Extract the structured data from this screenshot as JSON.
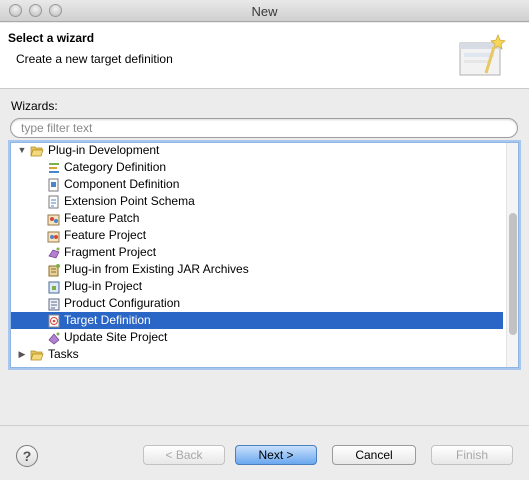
{
  "window": {
    "title": "New"
  },
  "header": {
    "title": "Select a wizard",
    "description": "Create a new target definition",
    "icon": "wizard-banner-icon"
  },
  "wizards_label": "Wizards:",
  "filter": {
    "placeholder": "type filter text",
    "value": ""
  },
  "tree": {
    "root": {
      "label": "Plug-in Development",
      "expanded": true
    },
    "children": [
      {
        "label": "Category Definition",
        "icon": "category-icon"
      },
      {
        "label": "Component Definition",
        "icon": "component-icon"
      },
      {
        "label": "Extension Point Schema",
        "icon": "schema-icon"
      },
      {
        "label": "Feature Patch",
        "icon": "feature-patch-icon"
      },
      {
        "label": "Feature Project",
        "icon": "feature-project-icon"
      },
      {
        "label": "Fragment Project",
        "icon": "fragment-icon"
      },
      {
        "label": "Plug-in from Existing JAR Archives",
        "icon": "jar-plugin-icon"
      },
      {
        "label": "Plug-in Project",
        "icon": "plugin-project-icon"
      },
      {
        "label": "Product Configuration",
        "icon": "product-icon"
      },
      {
        "label": "Target Definition",
        "icon": "target-icon",
        "selected": true
      },
      {
        "label": "Update Site Project",
        "icon": "update-site-icon"
      }
    ],
    "sibling": {
      "label": "Tasks",
      "expanded": false
    }
  },
  "buttons": {
    "back": "< Back",
    "next": "Next >",
    "cancel": "Cancel",
    "finish": "Finish",
    "help": "?"
  },
  "colors": {
    "selection": "#2a66c6",
    "accent": "#6aa7ef"
  }
}
